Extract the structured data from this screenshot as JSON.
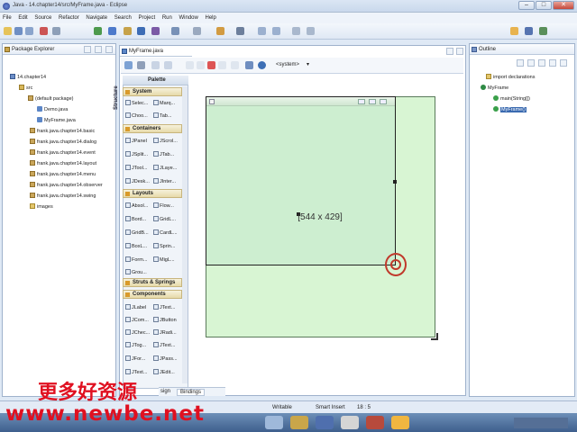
{
  "window": {
    "title": "Java - 14.chapter14/src/MyFrame.java - Eclipse",
    "minimize": "–",
    "maximize": "□",
    "close": "✕"
  },
  "menu": [
    "File",
    "Edit",
    "Source",
    "Refactor",
    "Navigate",
    "Search",
    "Project",
    "Run",
    "Window",
    "Help"
  ],
  "package_explorer": {
    "tab": "Package Explorer",
    "tree": [
      {
        "label": "14.chapter14",
        "icon": "project-icon"
      },
      {
        "label": "src",
        "icon": "source-folder-icon"
      },
      {
        "label": "(default package)",
        "icon": "package-icon"
      },
      {
        "label": "Demo.java",
        "icon": "java-file-icon"
      },
      {
        "label": "MyFrame.java",
        "icon": "java-file-icon"
      },
      {
        "label": "frank.java.chapter14.basic",
        "icon": "package-icon"
      },
      {
        "label": "frank.java.chapter14.dialog",
        "icon": "package-icon"
      },
      {
        "label": "frank.java.chapter14.event",
        "icon": "package-icon"
      },
      {
        "label": "frank.java.chapter14.layout",
        "icon": "package-icon"
      },
      {
        "label": "frank.java.chapter14.menu",
        "icon": "package-icon"
      },
      {
        "label": "frank.java.chapter14.observer",
        "icon": "package-icon"
      },
      {
        "label": "frank.java.chapter14.swing",
        "icon": "package-icon"
      },
      {
        "label": "images",
        "icon": "folder-icon"
      }
    ]
  },
  "editor": {
    "tab": "MyFrame.java",
    "lookandfeel": "<system>",
    "structure_label": "Structure",
    "palette_title": "Palette",
    "frame_size": "[544 x 429]",
    "bottom_tabs": [
      "Design",
      "Bindings"
    ],
    "bottom_tab_visible": [
      "sign",
      "Bindings"
    ]
  },
  "palette": {
    "system": {
      "title": "System",
      "items": [
        "Selec...",
        "Marq...",
        "Choo...",
        "Tab..."
      ]
    },
    "containers": {
      "title": "Containers",
      "items": [
        "JPanel",
        "JScrol...",
        "JSplit...",
        "JTab...",
        "JTool...",
        "JLaye...",
        "JDesk...",
        "JInter..."
      ]
    },
    "layouts": {
      "title": "Layouts",
      "items": [
        "Absol...",
        "Flow...",
        "Bord...",
        "GridL...",
        "GridB...",
        "CardL...",
        "BoxL...",
        "Sprin...",
        "Form...",
        "MigL...",
        "Grou..."
      ]
    },
    "struts": {
      "title": "Struts & Springs"
    },
    "components": {
      "title": "Components",
      "items": [
        "JLabel",
        "JText...",
        "JCom...",
        "JButton",
        "JChec...",
        "JRadi...",
        "JTog...",
        "JText...",
        "JFor...",
        "JPass...",
        "JText...",
        "JEdit..."
      ]
    }
  },
  "outline": {
    "tab": "Outline",
    "items": [
      "import declarations",
      "MyFrame",
      "main(String[])",
      "MyFrame()"
    ]
  },
  "status": {
    "writable": "Writable",
    "insert": "Smart Insert",
    "position": "18 : 5"
  },
  "watermark": {
    "cn": "更多好资源",
    "url": "www.newbe.net"
  },
  "colors": {
    "frame_fill": "#d4f2d4",
    "frame_border": "#2a2a2a",
    "accent": "#3a6ab0",
    "watermark": "#e01020"
  }
}
